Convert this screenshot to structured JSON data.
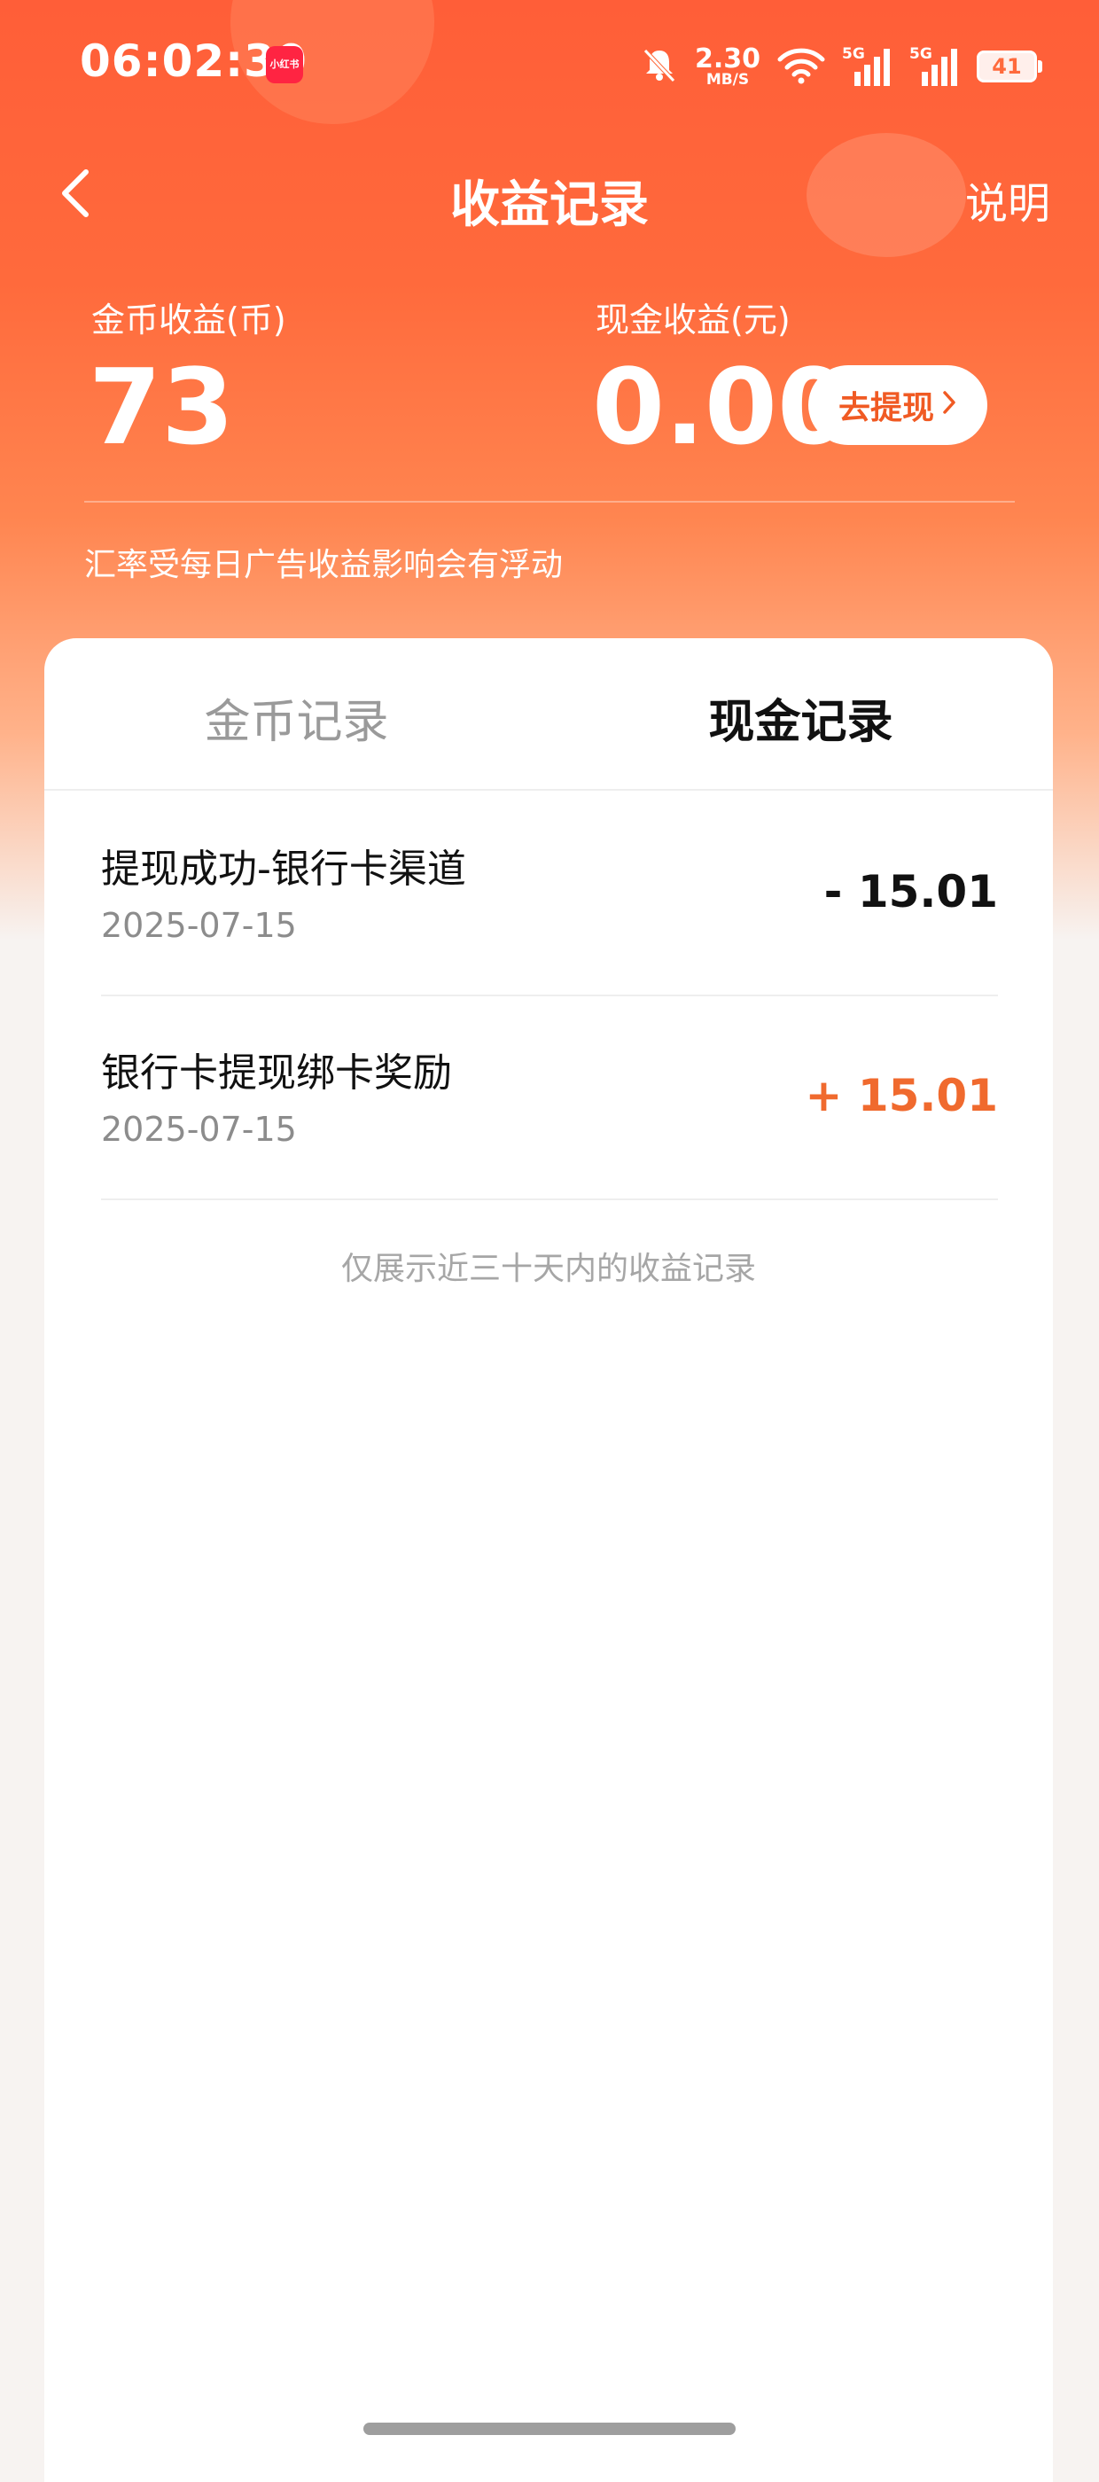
{
  "status_bar": {
    "time": "06:02:30",
    "app_badge": "小红书",
    "net_speed_value": "2.30",
    "net_speed_unit": "MB/S",
    "signal_1": "5G",
    "signal_2": "5G",
    "battery": "41"
  },
  "nav": {
    "title": "收益记录",
    "help": "说明"
  },
  "summary": {
    "coin_label": "金币收益(币)",
    "coin_value": "73",
    "cash_label": "现金收益(元)",
    "cash_value": "0.00",
    "withdraw_label": "去提现",
    "rate_note": "汇率受每日广告收益影响会有浮动"
  },
  "tabs": [
    {
      "label": "金币记录",
      "active": false
    },
    {
      "label": "现金记录",
      "active": true
    }
  ],
  "records": [
    {
      "title": "提现成功-银行卡渠道",
      "date": "2025-07-15",
      "amount": "- 15.01"
    },
    {
      "title": "银行卡提现绑卡奖励",
      "date": "2025-07-15",
      "amount": "+ 15.01"
    }
  ],
  "footer_note": "仅展示近三十天内的收益记录",
  "colors": {
    "brand_orange": "#ff5e38",
    "positive_amount": "#f06a2e",
    "withdraw_text": "#f05a23"
  }
}
